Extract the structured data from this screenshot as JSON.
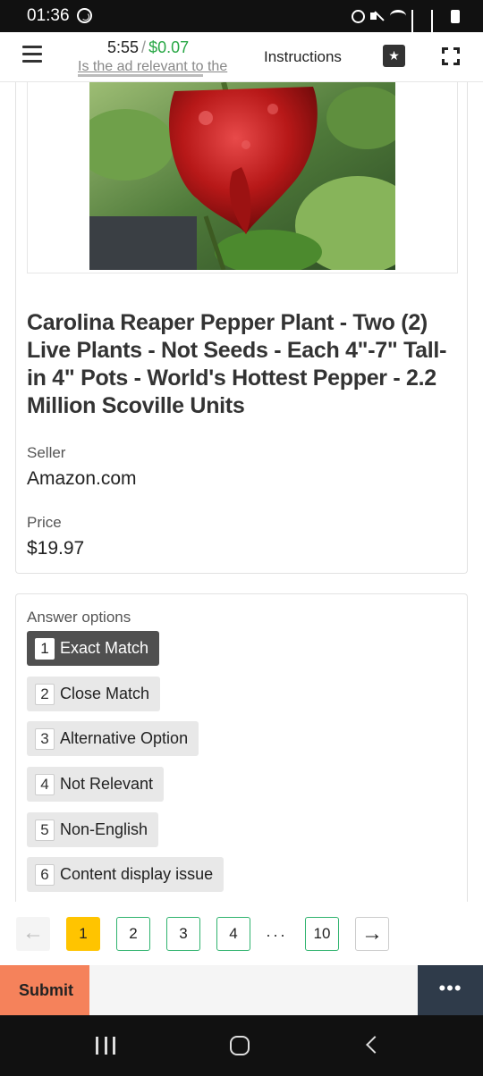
{
  "status_bar": {
    "time": "01:36"
  },
  "toolbar": {
    "timer": "5:55",
    "separator": "/",
    "earnings": "$0.07",
    "task_question": "Is the ad relevant to the",
    "instructions_label": "Instructions"
  },
  "product": {
    "title": "Carolina Reaper Pepper Plant - Two (2) Live Plants - Not Seeds - Each 4\"-7\" Tall- in 4\" Pots - World's Hottest Pepper - 2.2 Million Scoville Units",
    "seller_label": "Seller",
    "seller": "Amazon.com",
    "price_label": "Price",
    "price": "$19.97"
  },
  "answers": {
    "label": "Answer options",
    "options": [
      {
        "key": "1",
        "label": "Exact Match"
      },
      {
        "key": "2",
        "label": "Close Match"
      },
      {
        "key": "3",
        "label": "Alternative Option"
      },
      {
        "key": "4",
        "label": "Not Relevant"
      },
      {
        "key": "5",
        "label": "Non-English"
      },
      {
        "key": "6",
        "label": "Content display issue"
      }
    ],
    "selected": "1"
  },
  "pagination": {
    "prev": "←",
    "pages": [
      "1",
      "2",
      "3",
      "4"
    ],
    "ellipsis": "···",
    "last": "10",
    "next": "→",
    "current": "1"
  },
  "actions": {
    "submit": "Submit",
    "more": "•••"
  },
  "icons": {
    "menu": "hamburger-icon",
    "star": "star-icon",
    "fullscreen": "fullscreen-icon",
    "more": "more-icon"
  },
  "colors": {
    "earnings": "#28a745",
    "selected_option": "#505050",
    "current_page": "#ffc400",
    "page_border": "#2fb36e",
    "submit": "#f5825b",
    "more": "#2f3b4a"
  }
}
